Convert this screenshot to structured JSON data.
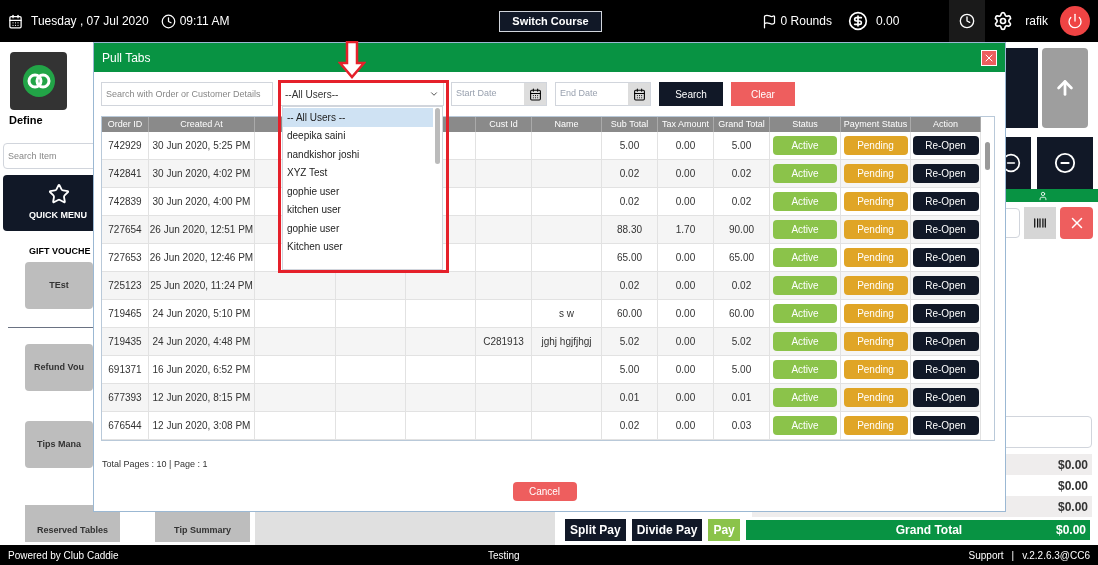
{
  "topbar": {
    "date": "Tuesday , 07 Jul 2020",
    "time": "09:11 AM",
    "switch_course": "Switch Course",
    "rounds": "0 Rounds",
    "balance": "0.00",
    "user": "rafik"
  },
  "left": {
    "brand": "Define",
    "search_placeholder": "Search Item",
    "quick_menu": "QUICK MENU",
    "section_title": "GIFT VOUCHE",
    "buttons": [
      {
        "label": "TEst"
      },
      {
        "label": "Refund Vou"
      },
      {
        "label": "Tips Mana"
      }
    ],
    "bottom_buttons": [
      {
        "label": "Reserved Tables"
      },
      {
        "label": "Tip Summary"
      }
    ]
  },
  "right": {
    "totals": [
      "$0.00",
      "$0.00",
      "$0.00"
    ],
    "pay_buttons": [
      {
        "label": "Split Pay",
        "kind": "dark"
      },
      {
        "label": "Divide Pay",
        "kind": "dark"
      },
      {
        "label": "Pay",
        "kind": "green"
      }
    ],
    "grand_total": {
      "label": "Grand Total",
      "value": "$0.00"
    }
  },
  "footer": {
    "powered": "Powered by Club Caddie",
    "center": "Testing",
    "support": "Support",
    "separator": "|",
    "version": "v.2.2.6.3@CC6"
  },
  "modal": {
    "title": "Pull Tabs",
    "search_placeholder": "Search with Order or Customer Details",
    "user_select": "--All Users--",
    "start_date_placeholder": "Start Date",
    "end_date_placeholder": "End Date",
    "search_button": "Search",
    "clear_button": "Clear",
    "user_options": [
      {
        "label": "-- All Users --",
        "selected": true
      },
      {
        "label": "deepika saini",
        "selected": false
      },
      {
        "label": "nandkishor joshi",
        "selected": false
      },
      {
        "label": "XYZ Test",
        "selected": false
      },
      {
        "label": "gophie user",
        "selected": false
      },
      {
        "label": "kitchen user",
        "selected": false
      },
      {
        "label": "gophie user",
        "selected": false
      },
      {
        "label": "Kitchen user",
        "selected": false
      }
    ],
    "columns": [
      "Order ID",
      "Created At",
      "",
      "",
      "",
      "Cust Id",
      "Name",
      "Sub Total",
      "Tax Amount",
      "Grand Total",
      "Status",
      "Payment Status",
      "Action"
    ],
    "rows": [
      {
        "order_id": "742929",
        "created_at": "30 Jun 2020, 5:25 PM",
        "cust_id": "",
        "name": "",
        "sub_total": "5.00",
        "tax": "0.00",
        "grand_total": "5.00",
        "status": "Active",
        "payment_status": "Pending",
        "action": "Re-Open"
      },
      {
        "order_id": "742841",
        "created_at": "30 Jun 2020, 4:02 PM",
        "cust_id": "",
        "name": "",
        "sub_total": "0.02",
        "tax": "0.00",
        "grand_total": "0.02",
        "status": "Active",
        "payment_status": "Pending",
        "action": "Re-Open"
      },
      {
        "order_id": "742839",
        "created_at": "30 Jun 2020, 4:00 PM",
        "cust_id": "",
        "name": "",
        "sub_total": "0.02",
        "tax": "0.00",
        "grand_total": "0.02",
        "status": "Active",
        "payment_status": "Pending",
        "action": "Re-Open"
      },
      {
        "order_id": "727654",
        "created_at": "26 Jun 2020, 12:51 PM",
        "cust_id": "",
        "name": "",
        "sub_total": "88.30",
        "tax": "1.70",
        "grand_total": "90.00",
        "status": "Active",
        "payment_status": "Pending",
        "action": "Re-Open"
      },
      {
        "order_id": "727653",
        "created_at": "26 Jun 2020, 12:46 PM",
        "cust_id": "",
        "name": "",
        "sub_total": "65.00",
        "tax": "0.00",
        "grand_total": "65.00",
        "status": "Active",
        "payment_status": "Pending",
        "action": "Re-Open"
      },
      {
        "order_id": "725123",
        "created_at": "25 Jun 2020, 11:24 PM",
        "cust_id": "",
        "name": "",
        "sub_total": "0.02",
        "tax": "0.00",
        "grand_total": "0.02",
        "status": "Active",
        "payment_status": "Pending",
        "action": "Re-Open"
      },
      {
        "order_id": "719465",
        "created_at": "24 Jun 2020, 5:10 PM",
        "cust_id": "",
        "name": "s w",
        "sub_total": "60.00",
        "tax": "0.00",
        "grand_total": "60.00",
        "status": "Active",
        "payment_status": "Pending",
        "action": "Re-Open"
      },
      {
        "order_id": "719435",
        "created_at": "24 Jun 2020, 4:48 PM",
        "cust_id": "C281913",
        "name": "jghj hgjfjhgj",
        "sub_total": "5.02",
        "tax": "0.00",
        "grand_total": "5.02",
        "status": "Active",
        "payment_status": "Pending",
        "action": "Re-Open"
      },
      {
        "order_id": "691371",
        "created_at": "16 Jun 2020, 6:52 PM",
        "cust_id": "",
        "name": "",
        "sub_total": "5.00",
        "tax": "0.00",
        "grand_total": "5.00",
        "status": "Active",
        "payment_status": "Pending",
        "action": "Re-Open"
      },
      {
        "order_id": "677393",
        "created_at": "12 Jun 2020, 8:15 PM",
        "cust_id": "",
        "name": "",
        "sub_total": "0.01",
        "tax": "0.00",
        "grand_total": "0.01",
        "status": "Active",
        "payment_status": "Pending",
        "action": "Re-Open"
      },
      {
        "order_id": "676544",
        "created_at": "12 Jun 2020, 3:08 PM",
        "cust_id": "",
        "name": "",
        "sub_total": "0.02",
        "tax": "0.00",
        "grand_total": "0.03",
        "status": "Active",
        "payment_status": "Pending",
        "action": "Re-Open"
      }
    ],
    "pager": "Total Pages : 10 | Page : 1",
    "cancel_button": "Cancel"
  }
}
